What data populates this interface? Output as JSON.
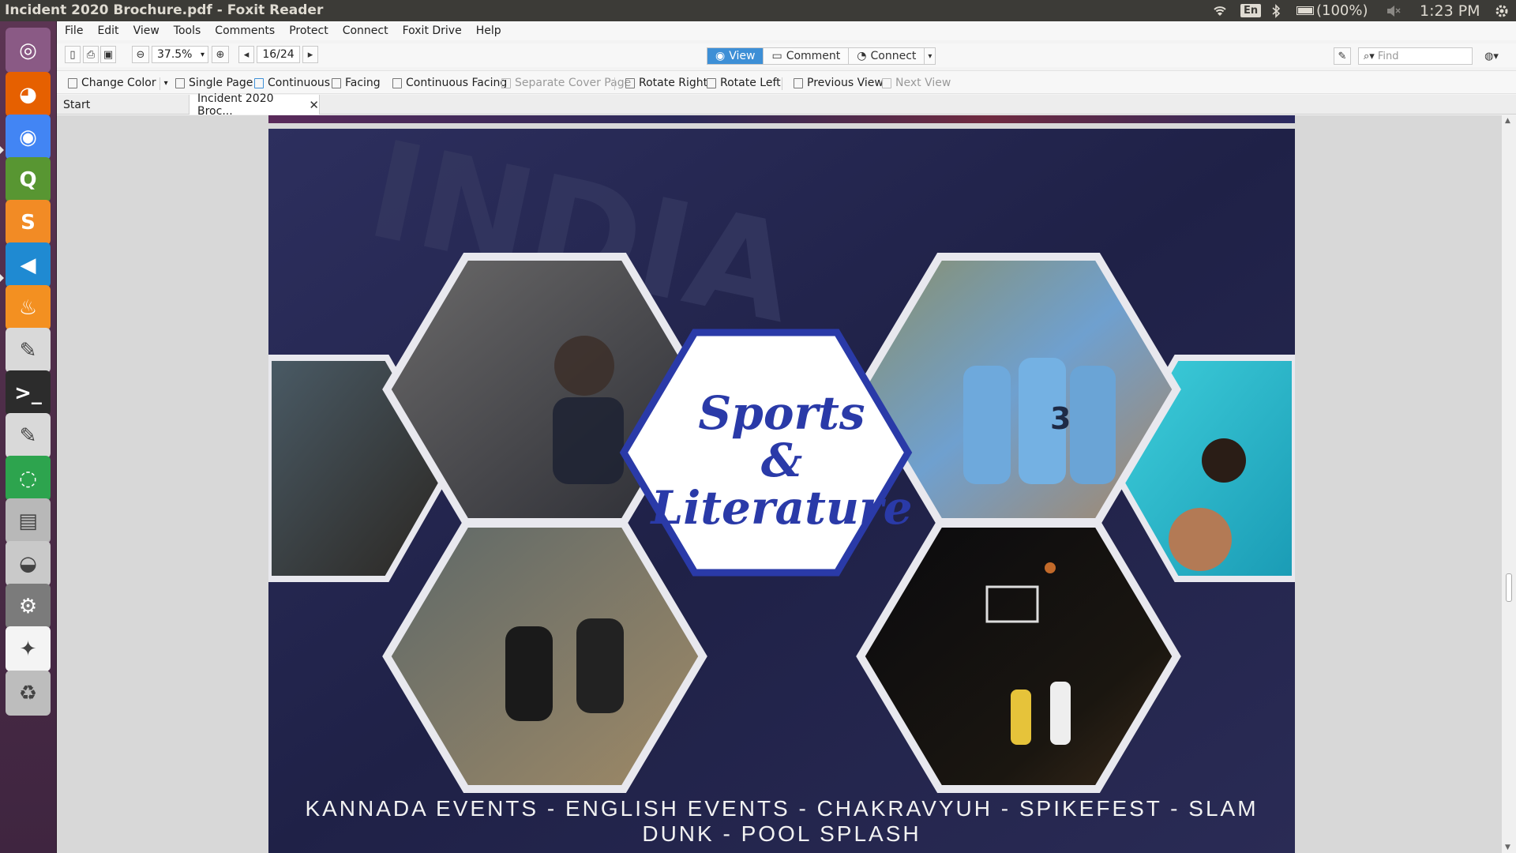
{
  "window": {
    "title": "Incident 2020 Brochure.pdf - Foxit Reader"
  },
  "tray": {
    "language": "En",
    "battery": "(100%)",
    "time": "1:23 PM"
  },
  "launcher": [
    {
      "name": "ubuntu-dash-icon",
      "color": "#8a5a85"
    },
    {
      "name": "firefox-icon",
      "color": "#e66000"
    },
    {
      "name": "chrome-icon",
      "color": "#4285f4"
    },
    {
      "name": "qgis-icon",
      "color": "#589632"
    },
    {
      "name": "sublime-text-icon",
      "color": "#f28b25"
    },
    {
      "name": "vscode-icon",
      "color": "#1f8ad2"
    },
    {
      "name": "foxit-pdf-icon",
      "color": "#f39021"
    },
    {
      "name": "text-editor-icon",
      "color": "#d9d9d9"
    },
    {
      "name": "terminal-icon",
      "color": "#2c2c2c"
    },
    {
      "name": "text-editor-icon-2",
      "color": "#d9d9d9"
    },
    {
      "name": "update-ring-icon",
      "color": "#2da44e"
    },
    {
      "name": "file-cabinet-icon",
      "color": "#b8b8b8"
    },
    {
      "name": "disk-drive-icon",
      "color": "#c9c9c9"
    },
    {
      "name": "system-settings-icon",
      "color": "#7b7b7b"
    },
    {
      "name": "app-logo-icon",
      "color": "#f4f4f4"
    },
    {
      "name": "trash-icon",
      "color": "#bdbdbd"
    }
  ],
  "menu": [
    "File",
    "Edit",
    "View",
    "Tools",
    "Comments",
    "Protect",
    "Connect",
    "Foxit Drive",
    "Help"
  ],
  "toolbar": {
    "zoom": "37.5%",
    "page": "16/24",
    "find_placeholder": "Find"
  },
  "modes": [
    "View",
    "Comment",
    "Connect"
  ],
  "toolbar2": {
    "change_color": "Change Color",
    "single_page": "Single Page",
    "continuous": "Continuous",
    "facing": "Facing",
    "continuous_facing": "Continuous Facing",
    "separate_cover": "Separate Cover Page",
    "rotate_right": "Rotate Right",
    "rotate_left": "Rotate Left",
    "previous_view": "Previous View",
    "next_view": "Next View"
  },
  "tabs": {
    "start": "Start",
    "doc": "Incident 2020 Broc..."
  },
  "page": {
    "title_line1": "Sports",
    "title_line2": "&",
    "title_line3": "Literature",
    "events": "KANNADA EVENTS - ENGLISH EVENTS - CHAKRAVYUH - SPIKEFEST - SLAM DUNK - POOL SPLASH",
    "accent": "#2a3aa8"
  }
}
